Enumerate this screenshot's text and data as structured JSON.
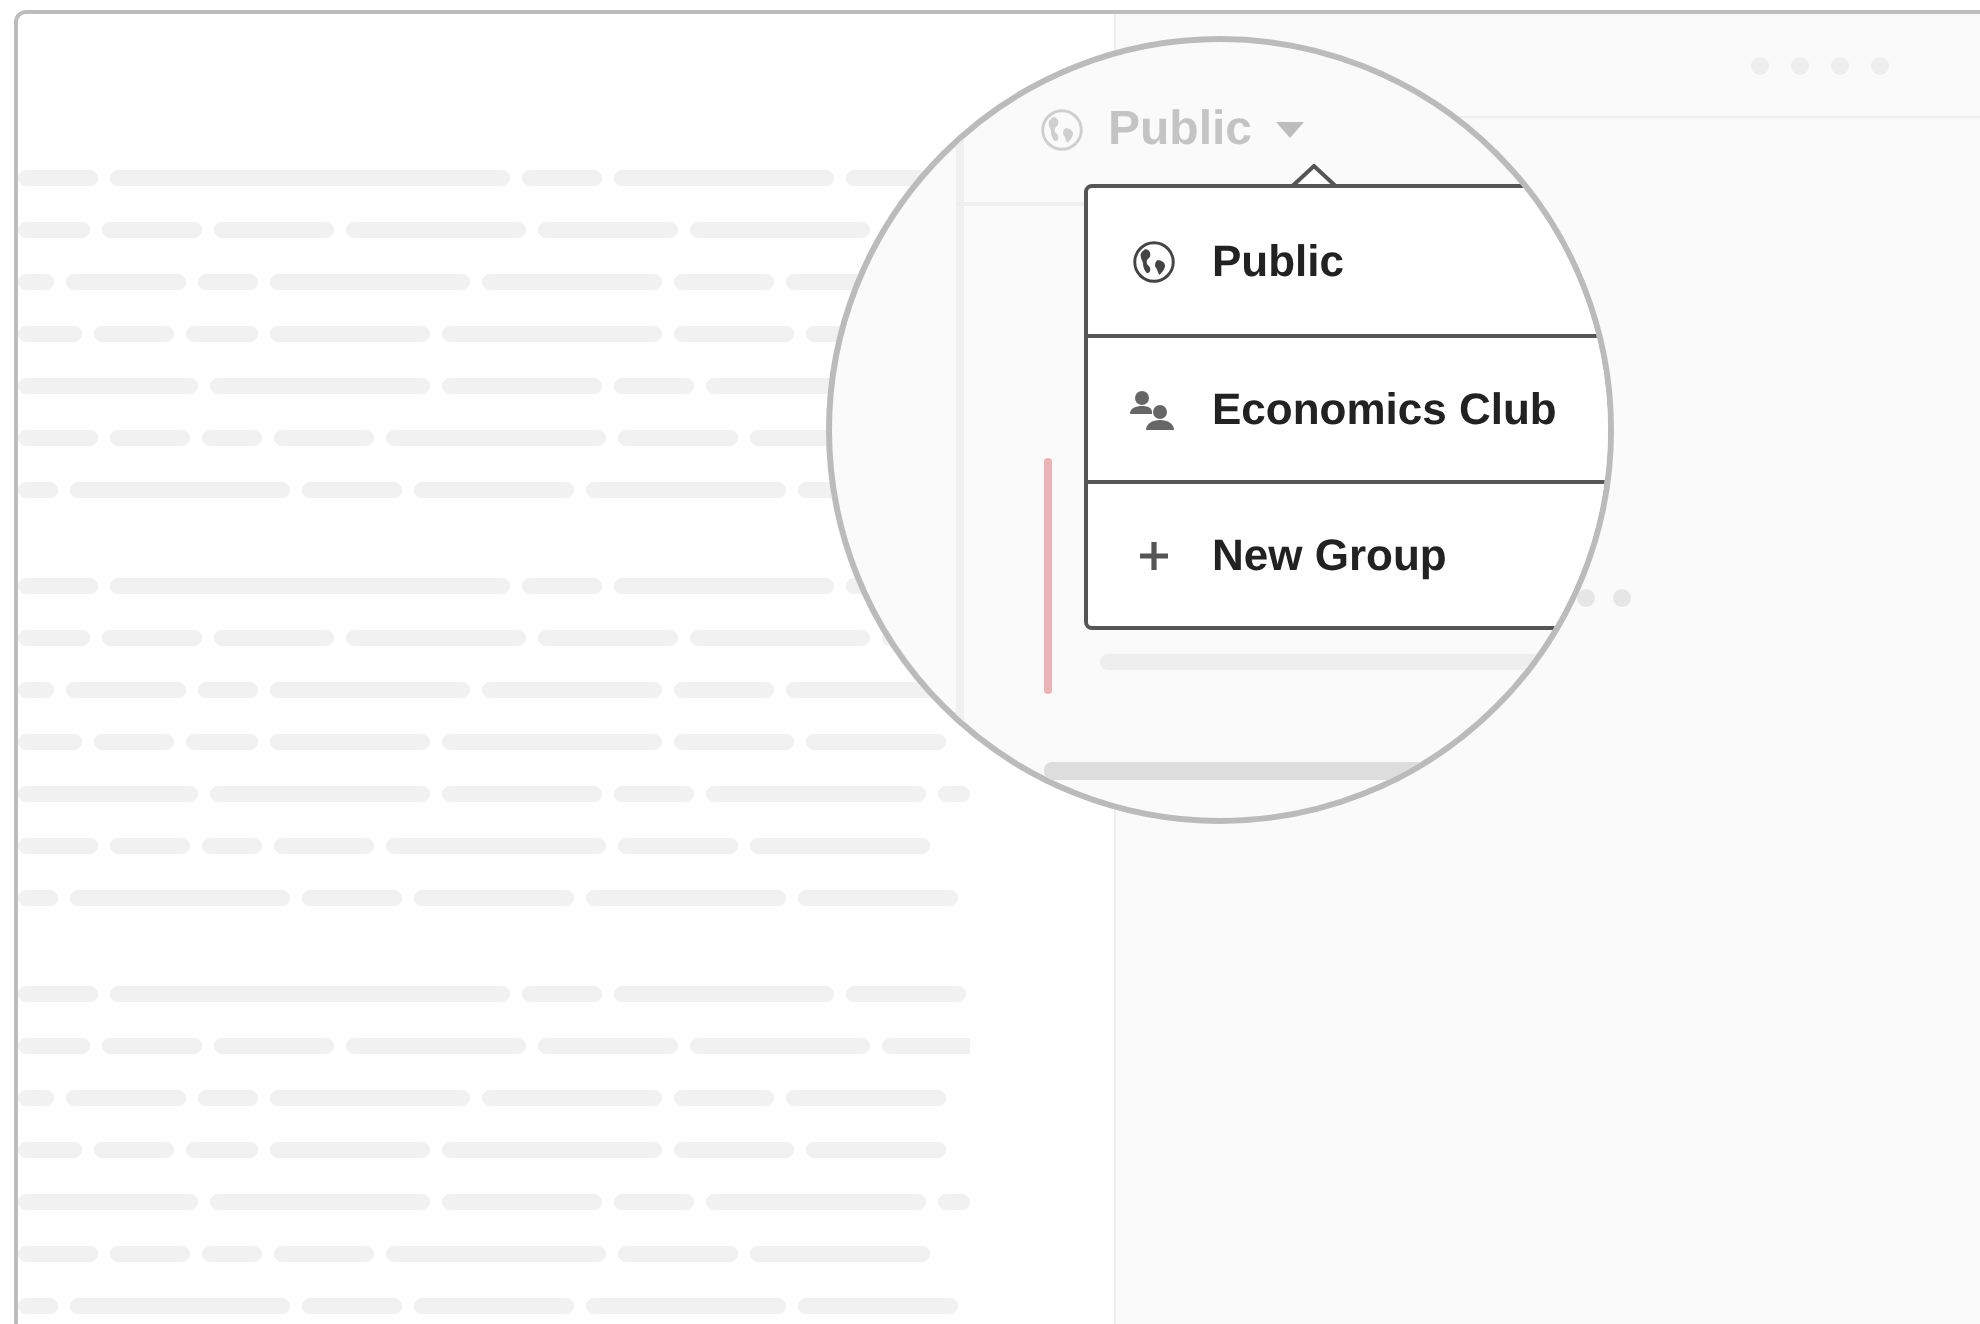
{
  "privacy_selector": {
    "label": "Public",
    "kind": "globe"
  },
  "menu": [
    {
      "kind": "globe",
      "label": "Public"
    },
    {
      "kind": "group",
      "label": "Economics Club"
    },
    {
      "kind": "add",
      "label": "New Group"
    }
  ]
}
